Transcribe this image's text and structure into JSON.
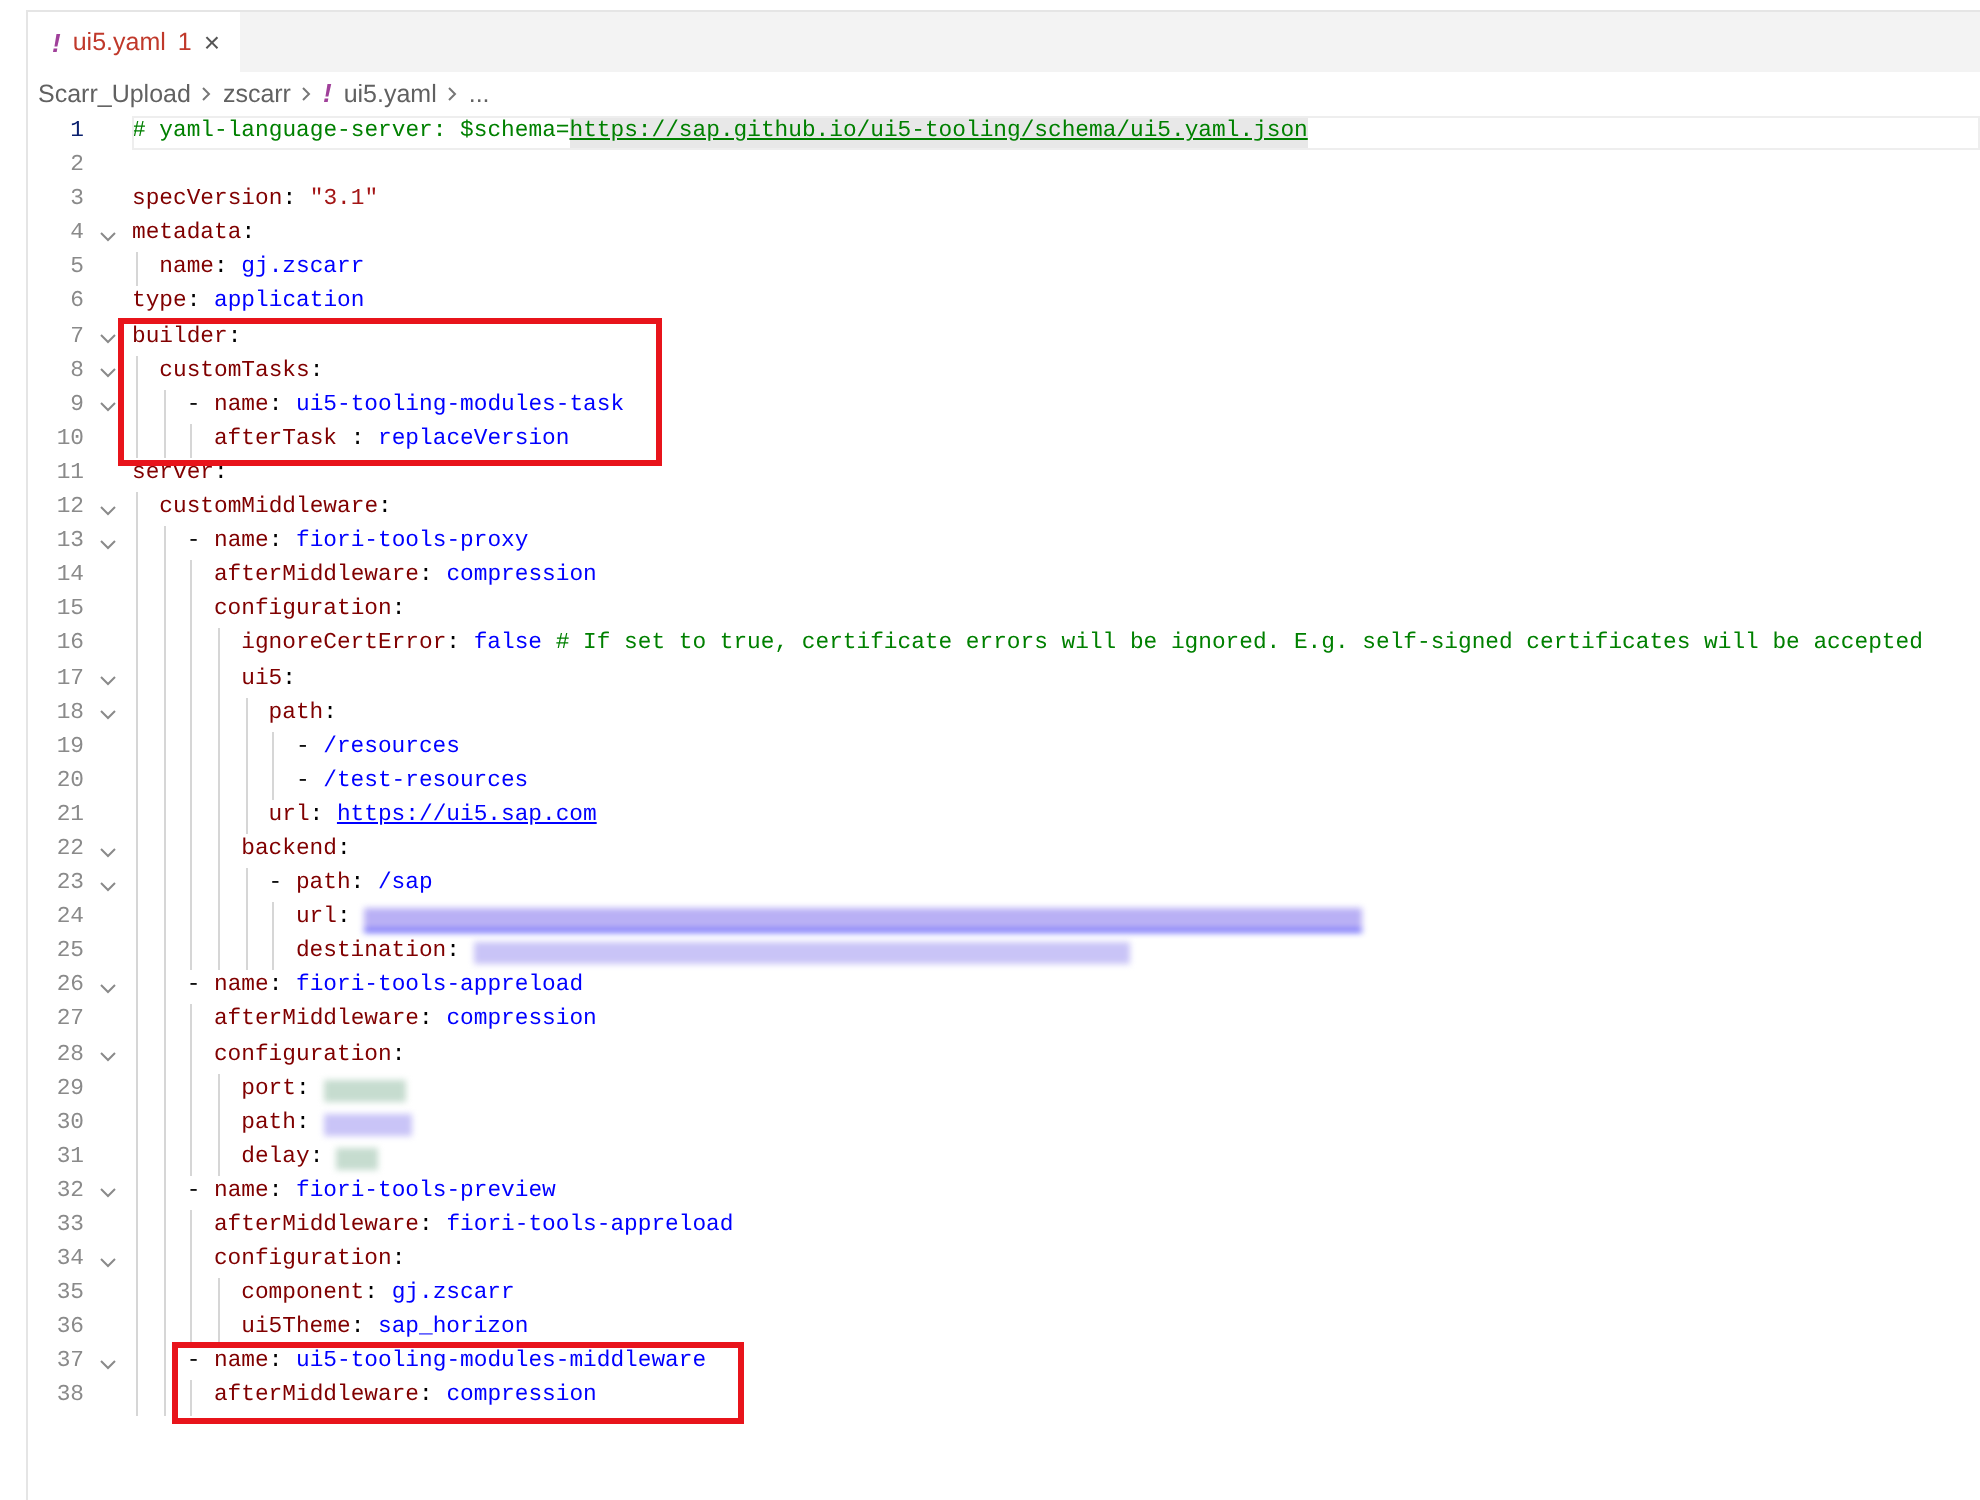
{
  "tabs": [
    {
      "icon": "!",
      "label": "ui5.yaml",
      "problems": "1",
      "close": "×",
      "has_errors": true,
      "selected": true
    }
  ],
  "breadcrumb": [
    {
      "label": "Scarr_Upload"
    },
    {
      "label": "zscarr"
    },
    {
      "icon": "!",
      "label": "ui5.yaml"
    },
    {
      "label": "..."
    }
  ],
  "lines": [
    {
      "number": "1",
      "current": true,
      "fold": false,
      "boxed": false,
      "tokens": [
        {
          "kind": "comment",
          "text": "# yaml-language-server: $schema="
        },
        {
          "kind": "comment-link",
          "text": "https://sap.github.io/ui5-tooling/schema/ui5.yaml.json"
        }
      ]
    },
    {
      "number": "2",
      "current": false,
      "fold": false,
      "boxed": false
    },
    {
      "number": "3",
      "current": false,
      "fold": false,
      "boxed": false,
      "tokens": [
        {
          "kind": "key",
          "text": "specVersion"
        },
        {
          "kind": "punct",
          "text": ": "
        },
        {
          "kind": "string",
          "text": "\"3.1\""
        }
      ]
    },
    {
      "number": "4",
      "current": false,
      "fold": true,
      "boxed": false,
      "tokens": [
        {
          "kind": "key",
          "text": "metadata"
        },
        {
          "kind": "punct",
          "text": ":"
        }
      ],
      "children": [
        {
          "number": "5",
          "current": false,
          "fold": false,
          "boxed": false,
          "tokens": [
            {
              "kind": "key",
              "text": "name"
            },
            {
              "kind": "punct",
              "text": ": "
            },
            {
              "kind": "value",
              "text": "gj.zscarr"
            }
          ]
        }
      ]
    },
    {
      "number": "6",
      "current": false,
      "fold": false,
      "boxed": false,
      "tokens": [
        {
          "kind": "key",
          "text": "type"
        },
        {
          "kind": "punct",
          "text": ": "
        },
        {
          "kind": "value",
          "text": "application"
        }
      ]
    },
    {
      "number": "7",
      "current": false,
      "fold": true,
      "boxed": true,
      "tokens": [
        {
          "kind": "key",
          "text": "builder"
        },
        {
          "kind": "punct",
          "text": ":"
        }
      ],
      "children": [
        {
          "number": "8",
          "current": false,
          "fold": true,
          "boxed": false,
          "tokens": [
            {
              "kind": "key",
              "text": "customTasks"
            },
            {
              "kind": "punct",
              "text": ":"
            }
          ],
          "children": [
            {
              "number": "9",
              "current": false,
              "fold": true,
              "boxed": false,
              "tokens": [
                {
                  "kind": "punct",
                  "text": "- "
                },
                {
                  "kind": "key",
                  "text": "name"
                },
                {
                  "kind": "punct",
                  "text": ": "
                },
                {
                  "kind": "value",
                  "text": "ui5-tooling-modules-task"
                }
              ],
              "children": [
                {
                  "number": "10",
                  "current": false,
                  "fold": false,
                  "boxed": false,
                  "tokens": [
                    {
                      "kind": "key",
                      "text": "afterTask"
                    },
                    {
                      "kind": "punct",
                      "text": " : "
                    },
                    {
                      "kind": "value",
                      "text": "replaceVersion"
                    }
                  ]
                }
              ]
            }
          ]
        }
      ]
    },
    {
      "number": "11",
      "current": false,
      "fold": false,
      "boxed": false,
      "tokens": [
        {
          "kind": "key",
          "text": "server"
        },
        {
          "kind": "punct",
          "text": ":"
        }
      ],
      "children": [
        {
          "number": "12",
          "current": false,
          "fold": true,
          "boxed": false,
          "tokens": [
            {
              "kind": "key",
              "text": "customMiddleware"
            },
            {
              "kind": "punct",
              "text": ":"
            }
          ],
          "children": [
            {
              "number": "13",
              "current": false,
              "fold": true,
              "boxed": false,
              "tokens": [
                {
                  "kind": "punct",
                  "text": "- "
                },
                {
                  "kind": "key",
                  "text": "name"
                },
                {
                  "kind": "punct",
                  "text": ": "
                },
                {
                  "kind": "value",
                  "text": "fiori-tools-proxy"
                }
              ],
              "children": [
                {
                  "number": "14",
                  "current": false,
                  "fold": false,
                  "boxed": false,
                  "tokens": [
                    {
                      "kind": "key",
                      "text": "afterMiddleware"
                    },
                    {
                      "kind": "punct",
                      "text": ": "
                    },
                    {
                      "kind": "value",
                      "text": "compression"
                    }
                  ]
                },
                {
                  "number": "15",
                  "current": false,
                  "fold": false,
                  "boxed": false,
                  "tokens": [
                    {
                      "kind": "key",
                      "text": "configuration"
                    },
                    {
                      "kind": "punct",
                      "text": ":"
                    }
                  ],
                  "children": [
                    {
                      "number": "16",
                      "current": false,
                      "fold": false,
                      "boxed": false,
                      "tokens": [
                        {
                          "kind": "key",
                          "text": "ignoreCertError"
                        },
                        {
                          "kind": "punct",
                          "text": ": "
                        },
                        {
                          "kind": "value",
                          "text": "false"
                        },
                        {
                          "kind": "comment",
                          "text": "# If set to true, certificate errors will be ignored. E.g. self-signed certificates will be accepted"
                        }
                      ]
                    },
                    {
                      "number": "17",
                      "current": false,
                      "fold": true,
                      "boxed": false,
                      "tokens": [
                        {
                          "kind": "key",
                          "text": "ui5"
                        },
                        {
                          "kind": "punct",
                          "text": ":"
                        }
                      ],
                      "children": [
                        {
                          "number": "18",
                          "current": false,
                          "fold": true,
                          "boxed": false,
                          "tokens": [
                            {
                              "kind": "key",
                              "text": "path"
                            },
                            {
                              "kind": "punct",
                              "text": ":"
                            }
                          ],
                          "children": [
                            {
                              "number": "19",
                              "current": false,
                              "fold": false,
                              "boxed": false,
                              "tokens": [
                                {
                                  "kind": "punct",
                                  "text": "- "
                                },
                                {
                                  "kind": "value",
                                  "text": "/resources"
                                }
                              ]
                            },
                            {
                              "number": "20",
                              "current": false,
                              "fold": false,
                              "boxed": false,
                              "tokens": [
                                {
                                  "kind": "punct",
                                  "text": "- "
                                },
                                {
                                  "kind": "value",
                                  "text": "/test-resources"
                                }
                              ]
                            }
                          ]
                        },
                        {
                          "number": "21",
                          "current": false,
                          "fold": false,
                          "boxed": false,
                          "tokens": [
                            {
                              "kind": "key",
                              "text": "url"
                            },
                            {
                              "kind": "punct",
                              "text": ": "
                            },
                            {
                              "kind": "link",
                              "text": "https://ui5.sap.com"
                            }
                          ]
                        }
                      ]
                    },
                    {
                      "number": "22",
                      "current": false,
                      "fold": true,
                      "boxed": false,
                      "tokens": [
                        {
                          "kind": "key",
                          "text": "backend"
                        },
                        {
                          "kind": "punct",
                          "text": ":"
                        }
                      ],
                      "children": [
                        {
                          "number": "23",
                          "current": false,
                          "fold": true,
                          "boxed": false,
                          "tokens": [
                            {
                              "kind": "punct",
                              "text": "- "
                            },
                            {
                              "kind": "key",
                              "text": "path"
                            },
                            {
                              "kind": "punct",
                              "text": ": "
                            },
                            {
                              "kind": "value",
                              "text": "/sap"
                            }
                          ],
                          "children": [
                            {
                              "number": "24",
                              "current": false,
                              "fold": false,
                              "boxed": false,
                              "tokens": [
                                {
                                  "kind": "key",
                                  "text": "url"
                                },
                                {
                                  "kind": "punct",
                                  "text": ": "
                                },
                                {
                                  "kind": "redacted-url"
                                }
                              ]
                            },
                            {
                              "number": "25",
                              "current": false,
                              "fold": false,
                              "boxed": false,
                              "tokens": [
                                {
                                  "kind": "key",
                                  "text": "destination"
                                },
                                {
                                  "kind": "punct",
                                  "text": ": "
                                },
                                {
                                  "kind": "redacted-destination"
                                }
                              ]
                            }
                          ]
                        }
                      ]
                    }
                  ]
                }
              ]
            },
            {
              "number": "26",
              "current": false,
              "fold": true,
              "boxed": false,
              "tokens": [
                {
                  "kind": "punct",
                  "text": "- "
                },
                {
                  "kind": "key",
                  "text": "name"
                },
                {
                  "kind": "punct",
                  "text": ": "
                },
                {
                  "kind": "value",
                  "text": "fiori-tools-appreload"
                }
              ],
              "children": [
                {
                  "number": "27",
                  "current": false,
                  "fold": false,
                  "boxed": false,
                  "tokens": [
                    {
                      "kind": "key",
                      "text": "afterMiddleware"
                    },
                    {
                      "kind": "punct",
                      "text": ": "
                    },
                    {
                      "kind": "value",
                      "text": "compression"
                    }
                  ]
                },
                {
                  "number": "28",
                  "current": false,
                  "fold": true,
                  "boxed": false,
                  "tokens": [
                    {
                      "kind": "key",
                      "text": "configuration"
                    },
                    {
                      "kind": "punct",
                      "text": ":"
                    }
                  ],
                  "children": [
                    {
                      "number": "29",
                      "current": false,
                      "fold": false,
                      "boxed": false,
                      "tokens": [
                        {
                          "kind": "key",
                          "text": "port"
                        },
                        {
                          "kind": "punct",
                          "text": ": "
                        },
                        {
                          "kind": "redacted-port"
                        }
                      ]
                    },
                    {
                      "number": "30",
                      "current": false,
                      "fold": false,
                      "boxed": false,
                      "tokens": [
                        {
                          "kind": "key",
                          "text": "path"
                        },
                        {
                          "kind": "punct",
                          "text": ": "
                        },
                        {
                          "kind": "redacted-path"
                        }
                      ]
                    },
                    {
                      "number": "31",
                      "current": false,
                      "fold": false,
                      "boxed": false,
                      "tokens": [
                        {
                          "kind": "key",
                          "text": "delay"
                        },
                        {
                          "kind": "punct",
                          "text": ": "
                        },
                        {
                          "kind": "redacted-delay"
                        }
                      ]
                    }
                  ]
                }
              ]
            },
            {
              "number": "32",
              "current": false,
              "fold": true,
              "boxed": false,
              "tokens": [
                {
                  "kind": "punct",
                  "text": "- "
                },
                {
                  "kind": "key",
                  "text": "name"
                },
                {
                  "kind": "punct",
                  "text": ": "
                },
                {
                  "kind": "value",
                  "text": "fiori-tools-preview"
                }
              ],
              "children": [
                {
                  "number": "33",
                  "current": false,
                  "fold": false,
                  "boxed": false,
                  "tokens": [
                    {
                      "kind": "key",
                      "text": "afterMiddleware"
                    },
                    {
                      "kind": "punct",
                      "text": ": "
                    },
                    {
                      "kind": "value",
                      "text": "fiori-tools-appreload"
                    }
                  ]
                },
                {
                  "number": "34",
                  "current": false,
                  "fold": true,
                  "boxed": false,
                  "tokens": [
                    {
                      "kind": "key",
                      "text": "configuration"
                    },
                    {
                      "kind": "punct",
                      "text": ":"
                    }
                  ],
                  "children": [
                    {
                      "number": "35",
                      "current": false,
                      "fold": false,
                      "boxed": false,
                      "tokens": [
                        {
                          "kind": "key",
                          "text": "component"
                        },
                        {
                          "kind": "punct",
                          "text": ": "
                        },
                        {
                          "kind": "value",
                          "text": "gj.zscarr"
                        }
                      ]
                    },
                    {
                      "number": "36",
                      "current": false,
                      "fold": false,
                      "boxed": false,
                      "tokens": [
                        {
                          "kind": "key",
                          "text": "ui5Theme"
                        },
                        {
                          "kind": "punct",
                          "text": ": "
                        },
                        {
                          "kind": "value",
                          "text": "sap_horizon"
                        }
                      ]
                    }
                  ]
                }
              ]
            },
            {
              "number": "37",
              "current": false,
              "fold": true,
              "boxed": true,
              "tokens": [
                {
                  "kind": "punct",
                  "text": "- "
                },
                {
                  "kind": "key",
                  "text": "name"
                },
                {
                  "kind": "punct",
                  "text": ": "
                },
                {
                  "kind": "value",
                  "text": "ui5-tooling-modules-middleware"
                }
              ],
              "children": [
                {
                  "number": "38",
                  "current": false,
                  "fold": false,
                  "boxed": false,
                  "tokens": [
                    {
                      "kind": "key",
                      "text": "afterMiddleware"
                    },
                    {
                      "kind": "punct",
                      "text": ": "
                    },
                    {
                      "kind": "value",
                      "text": "compression"
                    }
                  ]
                }
              ]
            }
          ]
        }
      ]
    }
  ]
}
